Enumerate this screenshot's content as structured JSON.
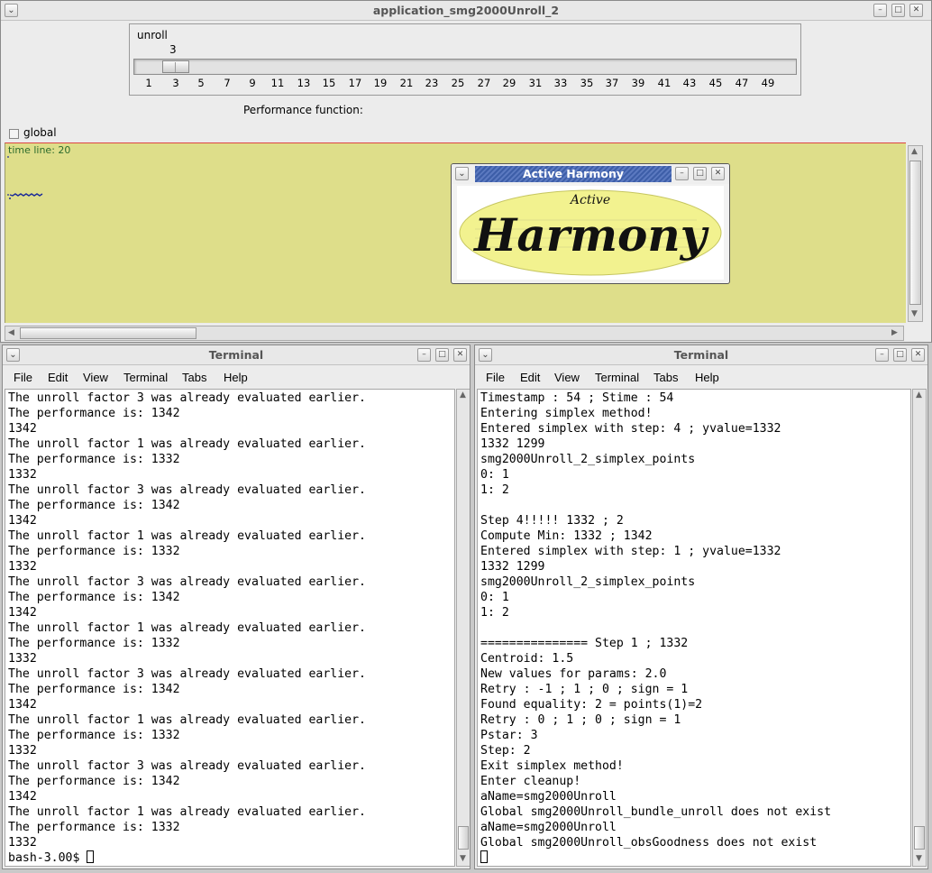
{
  "app": {
    "title": "application_smg2000Unroll_2",
    "unroll_label": "unroll",
    "unroll_value": "3",
    "slider_ticks": [
      "1",
      "3",
      "5",
      "7",
      "9",
      "11",
      "13",
      "15",
      "17",
      "19",
      "21",
      "23",
      "25",
      "27",
      "29",
      "31",
      "33",
      "35",
      "37",
      "39",
      "41",
      "43",
      "45",
      "47",
      "49"
    ],
    "performance_label": "Performance function:",
    "global_label": "global",
    "timeline_label": "time line: 20"
  },
  "harmony": {
    "title": "Active Harmony",
    "logo_top": "Active",
    "logo_main": "Harmony",
    "logo_fill": "#f2f28f"
  },
  "term1": {
    "title": "Terminal",
    "menu": [
      "File",
      "Edit",
      "View",
      "Terminal",
      "Tabs",
      "Help"
    ],
    "lines": [
      "The unroll factor 3 was already evaluated earlier.",
      "The performance is: 1342",
      "1342",
      "The unroll factor 1 was already evaluated earlier.",
      "The performance is: 1332",
      "1332",
      "The unroll factor 3 was already evaluated earlier.",
      "The performance is: 1342",
      "1342",
      "The unroll factor 1 was already evaluated earlier.",
      "The performance is: 1332",
      "1332",
      "The unroll factor 3 was already evaluated earlier.",
      "The performance is: 1342",
      "1342",
      "The unroll factor 1 was already evaluated earlier.",
      "The performance is: 1332",
      "1332",
      "The unroll factor 3 was already evaluated earlier.",
      "The performance is: 1342",
      "1342",
      "The unroll factor 1 was already evaluated earlier.",
      "The performance is: 1332",
      "1332",
      "The unroll factor 3 was already evaluated earlier.",
      "The performance is: 1342",
      "1342",
      "The unroll factor 1 was already evaluated earlier.",
      "The performance is: 1332",
      "1332"
    ],
    "prompt": "bash-3.00$ "
  },
  "term2": {
    "title": "Terminal",
    "menu": [
      "File",
      "Edit",
      "View",
      "Terminal",
      "Tabs",
      "Help"
    ],
    "lines": [
      "Timestamp : 54 ; Stime : 54",
      "Entering simplex method!",
      "Entered simplex with step: 4 ; yvalue=1332",
      "1332 1299",
      "smg2000Unroll_2_simplex_points",
      "0: 1",
      "1: 2",
      "",
      "Step 4!!!!! 1332 ; 2",
      "Compute Min: 1332 ; 1342",
      "Entered simplex with step: 1 ; yvalue=1332",
      "1332 1299",
      "smg2000Unroll_2_simplex_points",
      "0: 1",
      "1: 2",
      "",
      "=============== Step 1 ; 1332",
      "Centroid: 1.5",
      "New values for params: 2.0",
      "Retry : -1 ; 1 ; 0 ; sign = 1",
      "Found equality: 2 = points(1)=2",
      "Retry : 0 ; 1 ; 0 ; sign = 1",
      "Pstar: 3",
      "Step: 2",
      "Exit simplex method!",
      "Enter cleanup!",
      "aName=smg2000Unroll",
      "Global smg2000Unroll_bundle_unroll does not exist",
      "aName=smg2000Unroll",
      "Global smg2000Unroll_obsGoodness does not exist"
    ]
  },
  "colors": {
    "plot_background": "#dede8a",
    "timeline_text": "#2c6b2c"
  }
}
